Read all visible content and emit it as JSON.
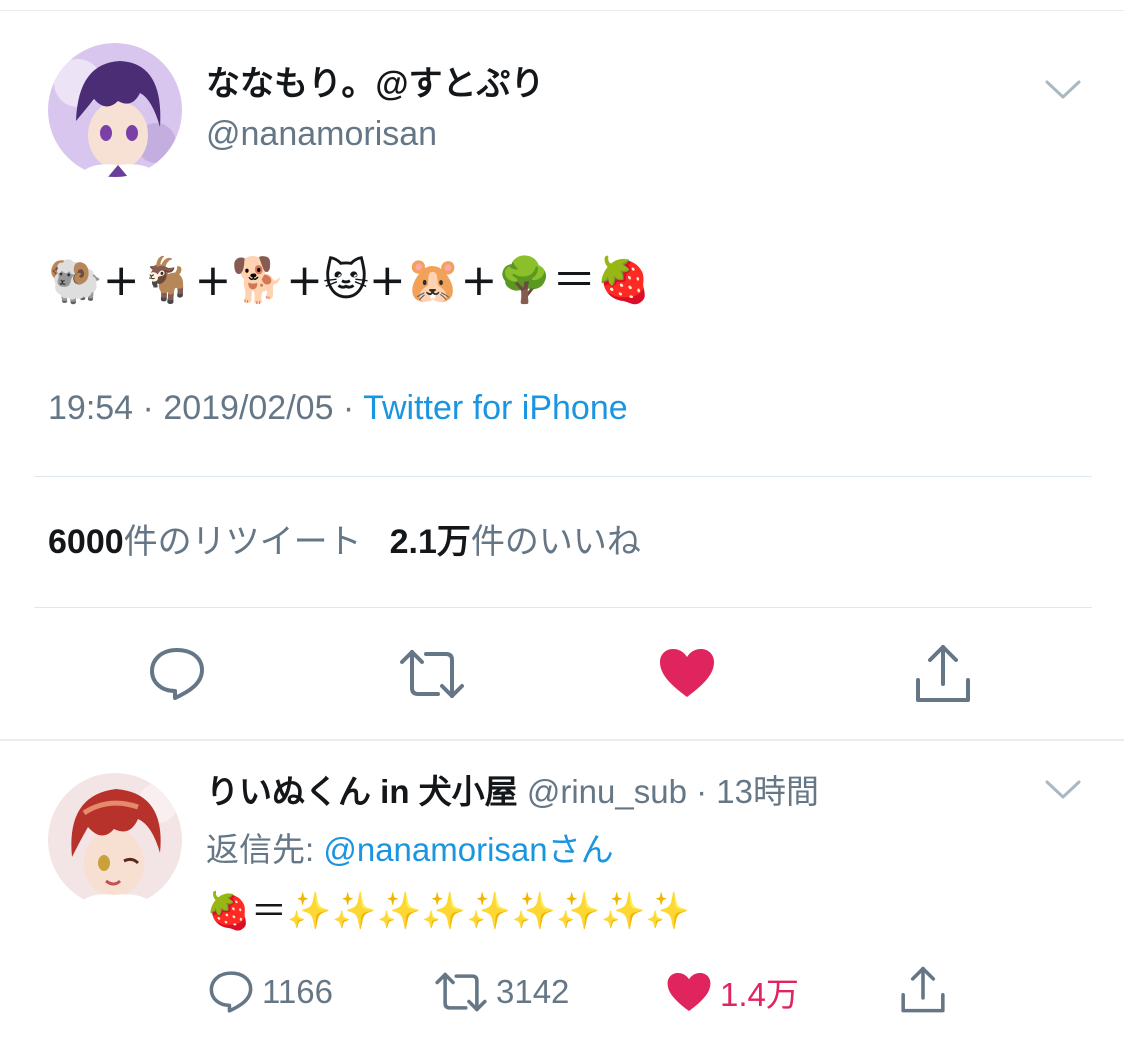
{
  "tweet": {
    "display_name": "ななもり。@すとぷり",
    "handle": "@nanamorisan",
    "text": "🐏+🐐+🐕+🐱+🐹+🌳＝🍓",
    "time": "19:54",
    "date": "2019/02/05",
    "separator": " · ",
    "source": "Twitter for iPhone",
    "retweet_count": "6000",
    "retweet_label": "件のリツイート",
    "like_count": "2.1万",
    "like_label": "件のいいね",
    "liked": true
  },
  "reply": {
    "display_name": "りいぬくん in 犬小屋",
    "handle": "@rinu_sub",
    "time_ago": "13時間",
    "replying_to_label": "返信先: ",
    "replying_to_mention": "@nanamorisan",
    "replying_to_suffix": "さん",
    "text": "🍓＝✨✨✨✨✨✨✨✨✨",
    "reply_count": "1166",
    "retweet_count": "3142",
    "like_count": "1.4万",
    "liked": true
  },
  "icons": {
    "reply": "comment-bubble-icon",
    "retweet": "retweet-arrows-icon",
    "like": "heart-icon",
    "share": "share-upload-icon",
    "more": "chevron-down-icon"
  },
  "colors": {
    "text": "#14171a",
    "secondary": "#657786",
    "link": "#1b95e0",
    "like": "#e0245e",
    "divider": "#e1e8ed"
  }
}
